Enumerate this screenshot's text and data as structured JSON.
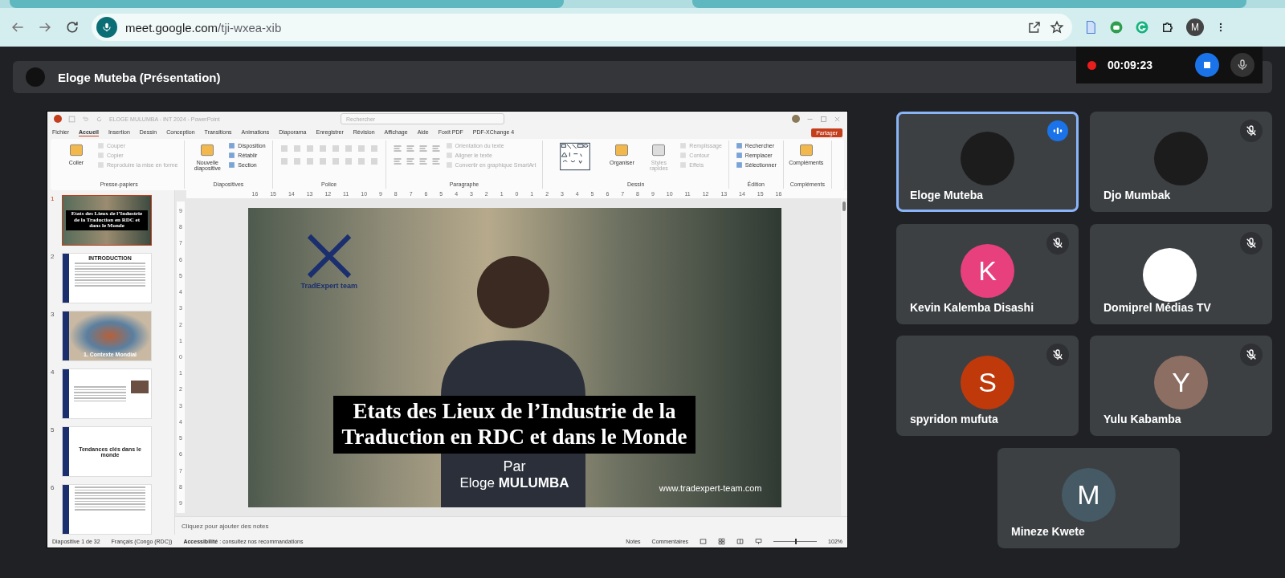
{
  "browser": {
    "url_domain": "meet.google.com",
    "url_path": "/tji-wxea-xib",
    "profile_initial": "M"
  },
  "meeting": {
    "presenter_title": "Eloge Muteba (Présentation)",
    "recording_time": "00:09:23"
  },
  "powerpoint": {
    "window_title": "ELOGE MULUMBA - INT 2024 - PowerPoint",
    "search_placeholder": "Rechercher",
    "share_label": "Partager",
    "tabs": [
      {
        "label": "Fichier",
        "selected": false
      },
      {
        "label": "Accueil",
        "selected": true
      },
      {
        "label": "Insertion",
        "selected": false
      },
      {
        "label": "Dessin",
        "selected": false
      },
      {
        "label": "Conception",
        "selected": false
      },
      {
        "label": "Transitions",
        "selected": false
      },
      {
        "label": "Animations",
        "selected": false
      },
      {
        "label": "Diaporama",
        "selected": false
      },
      {
        "label": "Enregistrer",
        "selected": false
      },
      {
        "label": "Révision",
        "selected": false
      },
      {
        "label": "Affichage",
        "selected": false
      },
      {
        "label": "Aide",
        "selected": false
      },
      {
        "label": "Foxit PDF",
        "selected": false
      },
      {
        "label": "PDF-XChange 4",
        "selected": false
      }
    ],
    "ribbon_groups": [
      {
        "name": "Presse-papiers",
        "items": [
          {
            "kind": "large",
            "label": "Coller",
            "disabled": false
          },
          {
            "kind": "small",
            "label": "Couper",
            "disabled": true
          },
          {
            "kind": "small",
            "label": "Copier",
            "disabled": true
          },
          {
            "kind": "small",
            "label": "Reproduire la mise en forme",
            "disabled": true
          }
        ]
      },
      {
        "name": "Diapositives",
        "items": [
          {
            "kind": "large",
            "label": "Nouvelle diapositive",
            "disabled": false
          },
          {
            "kind": "small",
            "label": "Disposition",
            "disabled": false
          },
          {
            "kind": "small",
            "label": "Rétablir",
            "disabled": false
          },
          {
            "kind": "small",
            "label": "Section",
            "disabled": false
          }
        ]
      },
      {
        "name": "Police",
        "items": [
          {
            "kind": "font-tools"
          }
        ]
      },
      {
        "name": "Paragraphe",
        "items": [
          {
            "kind": "paragraph-tools"
          },
          {
            "kind": "small",
            "label": "Orientation du texte",
            "disabled": true
          },
          {
            "kind": "small",
            "label": "Aligner le texte",
            "disabled": true
          },
          {
            "kind": "small",
            "label": "Convertir en graphique SmartArt",
            "disabled": true
          }
        ]
      },
      {
        "name": "Dessin",
        "items": [
          {
            "kind": "shapes"
          },
          {
            "kind": "large",
            "label": "Organiser",
            "disabled": false
          },
          {
            "kind": "large",
            "label": "Styles rapides",
            "disabled": true
          },
          {
            "kind": "small",
            "label": "Remplissage",
            "disabled": true
          },
          {
            "kind": "small",
            "label": "Contour",
            "disabled": true
          },
          {
            "kind": "small",
            "label": "Effets",
            "disabled": true
          }
        ]
      },
      {
        "name": "Édition",
        "items": [
          {
            "kind": "small",
            "label": "Rechercher",
            "disabled": false
          },
          {
            "kind": "small",
            "label": "Remplacer",
            "disabled": false
          },
          {
            "kind": "small",
            "label": "Sélectionner",
            "disabled": false
          }
        ]
      },
      {
        "name": "Compléments",
        "items": [
          {
            "kind": "large",
            "label": "Compléments",
            "disabled": false
          }
        ]
      }
    ],
    "horizontal_ruler": [
      "16",
      "15",
      "14",
      "13",
      "12",
      "11",
      "10",
      "9",
      "8",
      "7",
      "6",
      "5",
      "4",
      "3",
      "2",
      "1",
      "0",
      "1",
      "2",
      "3",
      "4",
      "5",
      "6",
      "7",
      "8",
      "9",
      "10",
      "11",
      "12",
      "13",
      "14",
      "15",
      "16"
    ],
    "vertical_ruler": [
      "9",
      "8",
      "7",
      "6",
      "5",
      "4",
      "3",
      "2",
      "1",
      "0",
      "1",
      "2",
      "3",
      "4",
      "5",
      "6",
      "7",
      "8",
      "9"
    ],
    "thumbnails": [
      {
        "number": "1",
        "selected": true,
        "kind": "photo-title",
        "text": "Etats des Lieux de l’Industrie de la Traduction en RDC et dans le Monde"
      },
      {
        "number": "2",
        "selected": false,
        "kind": "text",
        "text": "INTRODUCTION"
      },
      {
        "number": "3",
        "selected": false,
        "kind": "section",
        "text": "1. Contexte Mondial"
      },
      {
        "number": "4",
        "selected": false,
        "kind": "text-image"
      },
      {
        "number": "5",
        "selected": false,
        "kind": "title",
        "text": "Tendances clés dans le monde"
      },
      {
        "number": "6",
        "selected": false,
        "kind": "text"
      }
    ],
    "slide": {
      "logo_text": "TradExpert team",
      "title_lines": [
        "Etats des Lieux de l’Industrie de la",
        "Traduction en RDC et dans le Monde"
      ],
      "by": "Par",
      "author": "Eloge **MULUMBA**",
      "website": "www.tradexpert-team.com"
    },
    "notes_placeholder": "Cliquez pour ajouter des notes",
    "status_bar": {
      "slide_count": "Diapositive 1 de 32",
      "language": "Français (Congo (RDC))",
      "accessibility": "**Accessibilité** : consultez nos recommandations",
      "notes": "Notes",
      "comments": "Commentaires",
      "zoom": {
        "level": 0.5,
        "reading": "102%"
      }
    }
  },
  "participants": [
    {
      "name": "Eloge Muteba",
      "kind": "photo",
      "speaking": true,
      "muted": false
    },
    {
      "name": "Djo Mumbak",
      "kind": "photo",
      "speaking": false,
      "muted": true
    },
    {
      "name": "Kevin Kalemba Disashi",
      "kind": "letter",
      "initial": "K",
      "color": "#e8407d",
      "speaking": false,
      "muted": true
    },
    {
      "name": "Domiprel Médias TV",
      "kind": "logo",
      "speaking": false,
      "muted": true
    },
    {
      "name": "spyridon mufuta",
      "kind": "letter",
      "initial": "S",
      "color": "#c0390b",
      "speaking": false,
      "muted": true
    },
    {
      "name": "Yulu Kabamba",
      "kind": "letter",
      "initial": "Y",
      "color": "#8d6e63",
      "speaking": false,
      "muted": true
    },
    {
      "name": "Mineze Kwete",
      "kind": "letter",
      "initial": "M",
      "color": "#455a64",
      "speaking": false,
      "muted": false
    }
  ]
}
